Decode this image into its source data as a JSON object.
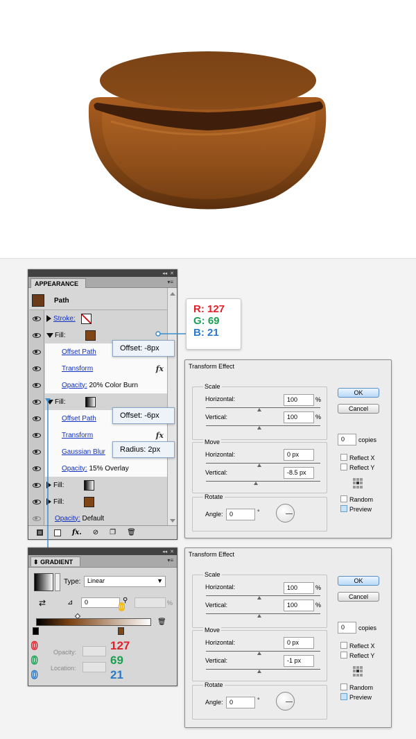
{
  "appearance": {
    "tab": "APPEARANCE",
    "header_label": "Path",
    "header_color": "#6b3a18",
    "rows": [
      {
        "label": "Stroke:",
        "kind": "stroke",
        "color": "none"
      },
      {
        "label": "Fill:",
        "kind": "fill",
        "color": "#7f4515"
      },
      {
        "label": "Offset Path",
        "kind": "effect"
      },
      {
        "label": "Transform",
        "kind": "effect"
      },
      {
        "label": "Opacity:",
        "value": "20% Color Burn",
        "kind": "opacity"
      },
      {
        "label": "Fill:",
        "kind": "fill",
        "color": "gradient"
      },
      {
        "label": "Offset Path",
        "kind": "effect"
      },
      {
        "label": "Transform",
        "kind": "effect"
      },
      {
        "label": "Gaussian Blur",
        "kind": "effect"
      },
      {
        "label": "Opacity:",
        "value": "15% Overlay",
        "kind": "opacity"
      },
      {
        "label": "Fill:",
        "kind": "fill",
        "color": "gradient"
      },
      {
        "label": "Fill:",
        "kind": "fill",
        "color": "#7f4515"
      },
      {
        "label": "Opacity:",
        "value": "Default",
        "kind": "opacity"
      }
    ],
    "fx_symbol": "fx"
  },
  "callouts": {
    "offset1": "Offset: -8px",
    "offset2": "Offset: -6px",
    "radius": "Radius: 2px"
  },
  "rgb": {
    "r": "R: 127",
    "g": "G: 69",
    "b": "B: 21"
  },
  "dialog1": {
    "title": "Transform Effect",
    "scale": "Scale",
    "horizontal": "Horizontal:",
    "vertical": "Vertical:",
    "scale_h": "100",
    "scale_v": "100",
    "percent": "%",
    "move": "Move",
    "move_h": "0 px",
    "move_v": "-8.5 px",
    "rotate": "Rotate",
    "angle": "Angle:",
    "angle_value": "0",
    "degree": "°",
    "ok": "OK",
    "cancel": "Cancel",
    "copies_value": "0",
    "copies": "copies",
    "reflect_x": "Reflect X",
    "reflect_y": "Reflect Y",
    "random": "Random",
    "preview": "Preview"
  },
  "dialog2": {
    "title": "Transform Effect",
    "scale": "Scale",
    "horizontal": "Horizontal:",
    "vertical": "Vertical:",
    "scale_h": "100",
    "scale_v": "100",
    "percent": "%",
    "move": "Move",
    "move_h": "0 px",
    "move_v": "-1 px",
    "rotate": "Rotate",
    "angle": "Angle:",
    "angle_value": "0",
    "degree": "°",
    "ok": "OK",
    "cancel": "Cancel",
    "copies_value": "0",
    "copies": "copies",
    "reflect_x": "Reflect X",
    "reflect_y": "Reflect Y",
    "random": "Random",
    "preview": "Preview"
  },
  "gradient": {
    "tab": "GRADIENT",
    "type_label": "Type:",
    "type_value": "Linear",
    "angle_value": "0",
    "percent": "%",
    "opacity_label": "Opacity:",
    "location_label": "Location:",
    "left_stop": [
      "0",
      "0",
      "0"
    ],
    "right_stop": [
      "127",
      "69",
      "21"
    ],
    "midpoint_value": "0"
  },
  "colors": {
    "red": "#e0202a",
    "green": "#1aa050",
    "blue": "#2a78c8",
    "yellow": "#f0b400",
    "bean_dark": "#7f4515"
  }
}
